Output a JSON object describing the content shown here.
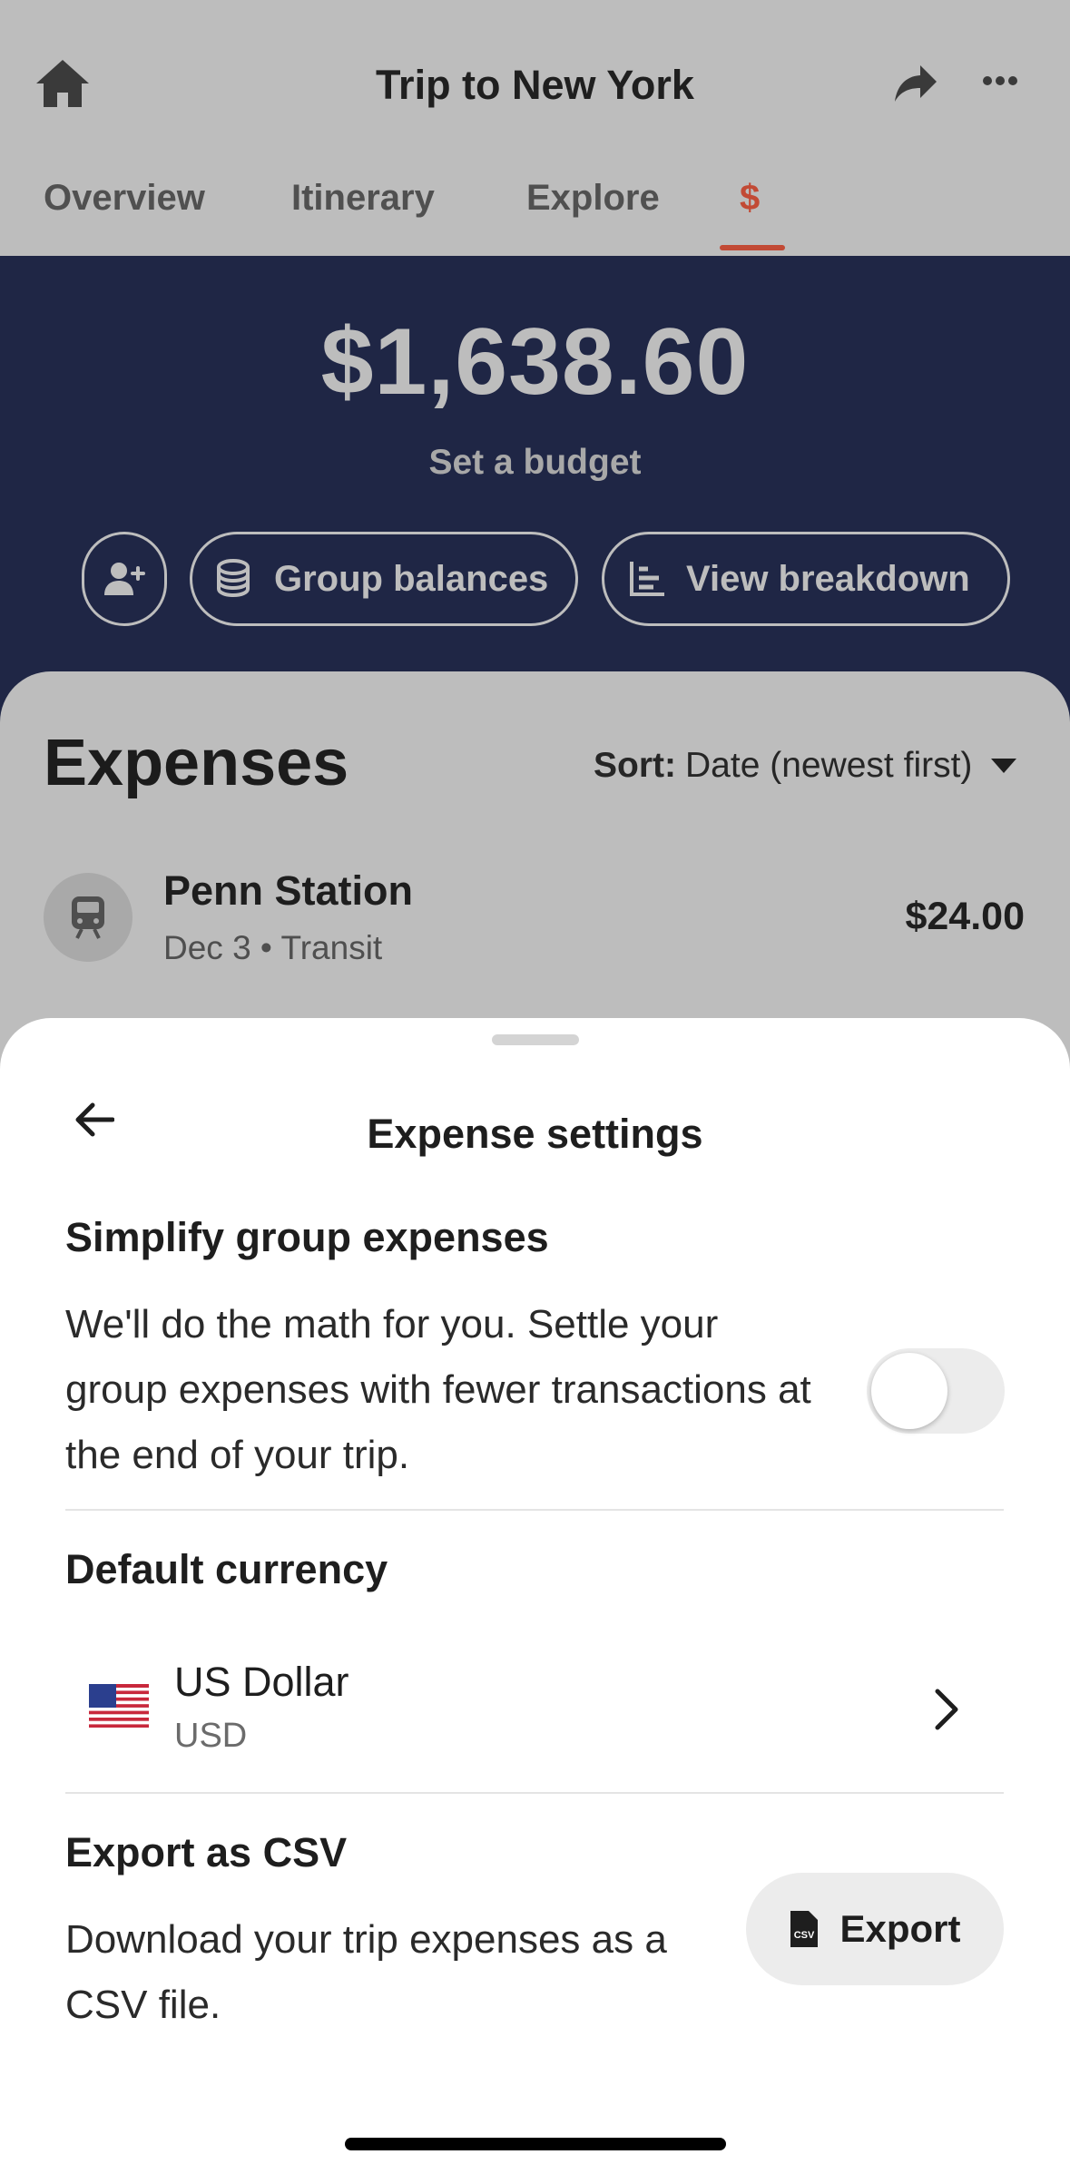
{
  "header": {
    "title": "Trip to New York",
    "home_icon": "home-icon",
    "share_icon": "share-icon",
    "more_icon": "more-icon"
  },
  "tabs": [
    {
      "label": "Overview",
      "active": false
    },
    {
      "label": "Itinerary",
      "active": false
    },
    {
      "label": "Explore",
      "active": false
    },
    {
      "label": "$",
      "active": true
    }
  ],
  "summary": {
    "total": "$1,638.60",
    "budget_link": "Set a budget",
    "group_balances_label": "Group balances",
    "view_breakdown_label": "View breakdown"
  },
  "expenses": {
    "title": "Expenses",
    "sort_label": "Sort:",
    "sort_value": "Date (newest first)",
    "items": [
      {
        "name": "Penn Station",
        "meta": "Dec 3 • Transit",
        "amount": "$24.00",
        "icon": "train-icon"
      }
    ]
  },
  "sheet": {
    "title": "Expense settings",
    "simplify": {
      "title": "Simplify group expenses",
      "line1": "We'll do the math for you. Settle your",
      "line2": "group expenses with fewer transactions at",
      "line3": "the end of your trip.",
      "enabled": false
    },
    "currency": {
      "title": "Default currency",
      "name": "US Dollar",
      "code": "USD",
      "flag_icon": "us-flag-icon"
    },
    "export": {
      "title": "Export as CSV",
      "line1": "Download your trip expenses as a",
      "line2": "CSV file.",
      "button_label": "Export"
    }
  },
  "colors": {
    "accent": "#c24a35",
    "hero_bg": "#1f2645",
    "overlay_bg": "#bdbdbd",
    "sheet_bg": "#ffffff"
  }
}
